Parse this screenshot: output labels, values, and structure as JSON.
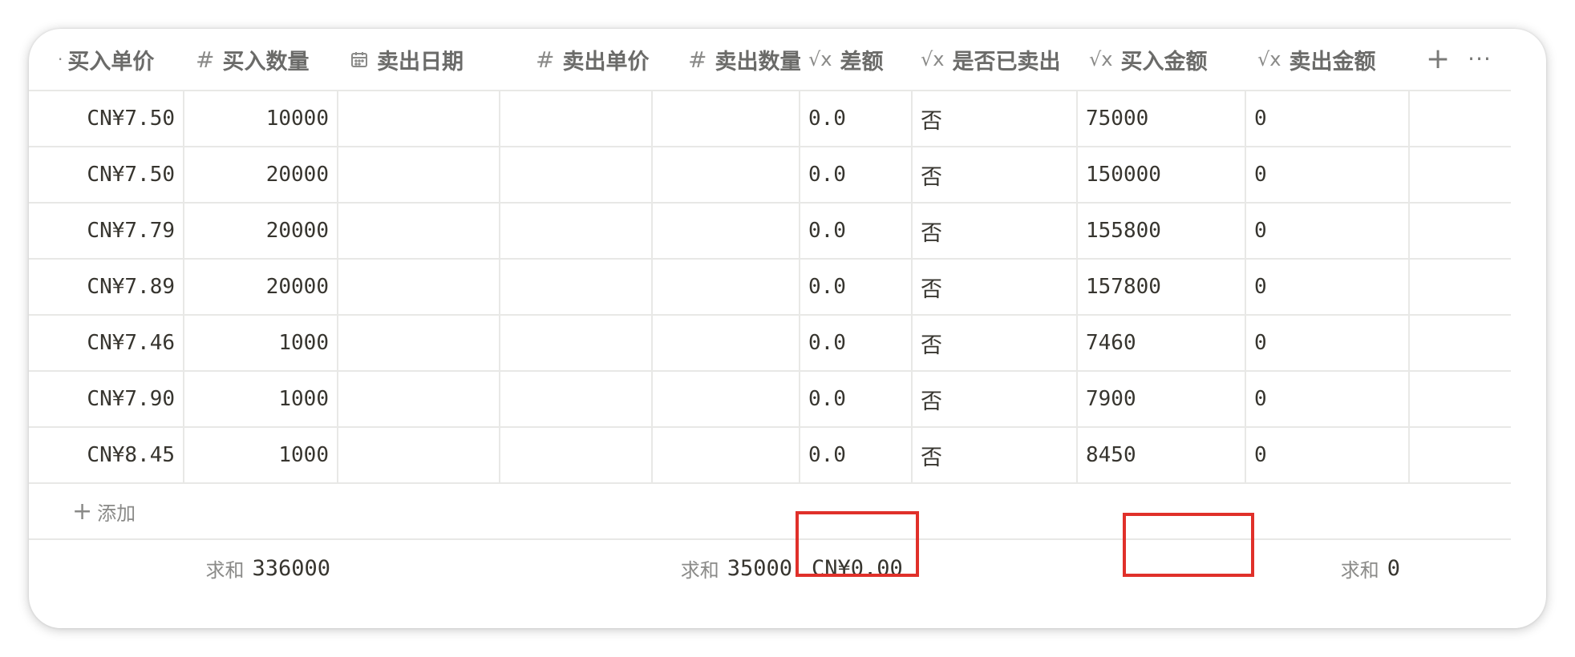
{
  "table": {
    "columns": [
      {
        "key": "buy_price",
        "label": "买入单价",
        "icon": "dot-icon"
      },
      {
        "key": "buy_qty",
        "label": "买入数量",
        "icon": "hash-icon"
      },
      {
        "key": "sell_date",
        "label": "卖出日期",
        "icon": "calendar-icon"
      },
      {
        "key": "sell_price",
        "label": "卖出单价",
        "icon": "hash-icon"
      },
      {
        "key": "sell_qty",
        "label": "卖出数量",
        "icon": "hash-icon"
      },
      {
        "key": "diff",
        "label": "差额",
        "icon": "formula-icon"
      },
      {
        "key": "sold",
        "label": "是否已卖出",
        "icon": "formula-icon"
      },
      {
        "key": "buy_amount",
        "label": "买入金额",
        "icon": "formula-icon"
      },
      {
        "key": "sell_amount",
        "label": "卖出金额",
        "icon": "formula-icon"
      }
    ],
    "icons": {
      "hash": "#",
      "formula": "√x",
      "dot": "·"
    },
    "rows": [
      {
        "buy_price": "CN¥7.50",
        "buy_qty": "10000",
        "sell_date": "",
        "sell_price": "",
        "sell_qty": "",
        "diff": "0.0",
        "sold": "否",
        "buy_amount": "75000",
        "sell_amount": "0"
      },
      {
        "buy_price": "CN¥7.50",
        "buy_qty": "20000",
        "sell_date": "",
        "sell_price": "",
        "sell_qty": "",
        "diff": "0.0",
        "sold": "否",
        "buy_amount": "150000",
        "sell_amount": "0"
      },
      {
        "buy_price": "CN¥7.79",
        "buy_qty": "20000",
        "sell_date": "",
        "sell_price": "",
        "sell_qty": "",
        "diff": "0.0",
        "sold": "否",
        "buy_amount": "155800",
        "sell_amount": "0"
      },
      {
        "buy_price": "CN¥7.89",
        "buy_qty": "20000",
        "sell_date": "",
        "sell_price": "",
        "sell_qty": "",
        "diff": "0.0",
        "sold": "否",
        "buy_amount": "157800",
        "sell_amount": "0"
      },
      {
        "buy_price": "CN¥7.46",
        "buy_qty": "1000",
        "sell_date": "",
        "sell_price": "",
        "sell_qty": "",
        "diff": "0.0",
        "sold": "否",
        "buy_amount": "7460",
        "sell_amount": "0"
      },
      {
        "buy_price": "CN¥7.90",
        "buy_qty": "1000",
        "sell_date": "",
        "sell_price": "",
        "sell_qty": "",
        "diff": "0.0",
        "sold": "否",
        "buy_amount": "7900",
        "sell_amount": "0"
      },
      {
        "buy_price": "CN¥8.45",
        "buy_qty": "1000",
        "sell_date": "",
        "sell_price": "",
        "sell_qty": "",
        "diff": "0.0",
        "sold": "否",
        "buy_amount": "8450",
        "sell_amount": "0"
      }
    ],
    "add_row_label": "添加",
    "add_row_plus": "+",
    "header_add": "+",
    "header_more": "···",
    "footer": {
      "buy_qty": {
        "label": "求和",
        "value": "336000"
      },
      "sell_qty": {
        "label": "求和",
        "value": "35000"
      },
      "diff": {
        "label": "",
        "value": "CN¥0.00"
      },
      "sell_amount": {
        "label": "求和",
        "value": "0"
      }
    }
  },
  "colors": {
    "highlight": "#e0302a",
    "border": "#e8e8e6",
    "text": "#37352f",
    "muted": "#8a8a88"
  }
}
